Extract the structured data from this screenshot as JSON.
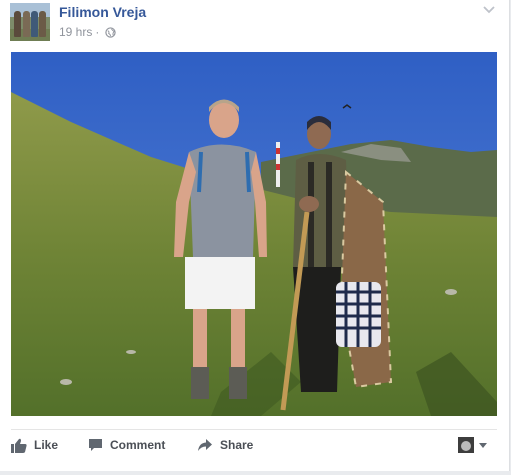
{
  "post": {
    "author_name": "Filimon Vreja",
    "timestamp": "19 hrs",
    "separator": "·",
    "privacy_icon": "globe-icon",
    "menu_icon": "chevron-down-icon"
  },
  "photo": {
    "alt_subject": "two-men-on-mountain-meadow"
  },
  "actions": {
    "like_label": "Like",
    "comment_label": "Comment",
    "share_label": "Share"
  },
  "colors": {
    "link_blue": "#365899",
    "meta_gray": "#90949c",
    "action_gray": "#4b4f56"
  }
}
